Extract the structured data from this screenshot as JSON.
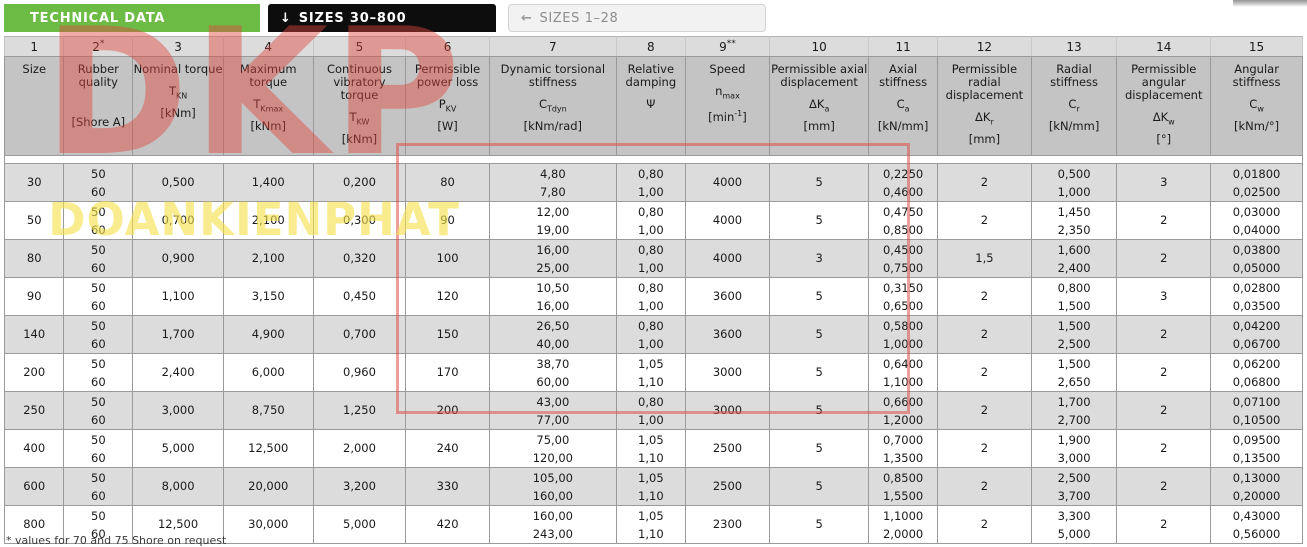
{
  "tabs": [
    {
      "label": "TECHNICAL DATA",
      "icon": "none",
      "state": "brand"
    },
    {
      "label": "SIZES 30–800",
      "icon": "down-arrow-icon",
      "arrow": "↓",
      "state": "active"
    },
    {
      "label": "SIZES 1–28",
      "icon": "left-arrow-icon",
      "arrow": "←",
      "state": "inactive"
    }
  ],
  "colors": {
    "brand_green": "#6cbb45",
    "active_tab": "#0d0d0d",
    "inactive_tab": "#f2f2f2",
    "header_number_bg": "#dcdcdc",
    "header_desc_bg": "#c4c4c4",
    "row_odd_bg": "#dcdcdc",
    "row_even_bg": "#ffffff",
    "watermark_red": "#e0483e",
    "watermark_yellow": "#f4e048"
  },
  "watermark": {
    "primary": "DKP",
    "secondary": "DOANKIENPHAT"
  },
  "footnote": "* values for 70 and 75 Shore on request",
  "table": {
    "column_numbers": [
      "1",
      "2",
      "3",
      "4",
      "5",
      "6",
      "7",
      "8",
      "9",
      "10",
      "11",
      "12",
      "13",
      "14",
      "15"
    ],
    "column_number_marks": [
      "",
      "*",
      "",
      "",
      "",
      "",
      "",
      "",
      "**",
      "",
      "",
      "",
      "",
      "",
      ""
    ],
    "columns": [
      {
        "name": "Size",
        "symbol": "",
        "unit": ""
      },
      {
        "name": "Rubber quality",
        "symbol": "",
        "unit": "[Shore A]"
      },
      {
        "name": "Nominal torque",
        "symbol": "T",
        "sub": "KN",
        "unit": "[kNm]"
      },
      {
        "name": "Maximum torque",
        "symbol": "T",
        "sub": "Kmax",
        "unit": "[kNm]"
      },
      {
        "name": "Continuous vibratory torque",
        "symbol": "T",
        "sub": "KW",
        "unit": "[kNm]"
      },
      {
        "name": "Permissible power loss",
        "symbol": "P",
        "sub": "KV",
        "unit": "[W]"
      },
      {
        "name": "Dynamic torsional stiffness",
        "symbol": "C",
        "sub": "Tdyn",
        "unit": "[kNm/rad]"
      },
      {
        "name": "Relative damping",
        "symbol": "Ψ",
        "sub": "",
        "unit": ""
      },
      {
        "name": "Speed",
        "symbol": "n",
        "sub": "max",
        "unit": "[min-1]"
      },
      {
        "name": "Permissible axial displacement",
        "symbol": "ΔK",
        "sub": "a",
        "unit": "[mm]"
      },
      {
        "name": "Axial stiffness",
        "symbol": "C",
        "sub": "a",
        "unit": "[kN/mm]"
      },
      {
        "name": "Permissible radial displacement",
        "symbol": "ΔK",
        "sub": "r",
        "unit": "[mm]"
      },
      {
        "name": "Radial stiffness",
        "symbol": "C",
        "sub": "r",
        "unit": "[kN/mm]"
      },
      {
        "name": "Permissible angular displacement",
        "symbol": "ΔK",
        "sub": "w",
        "unit": "[°]"
      },
      {
        "name": "Angular stiffness",
        "symbol": "C",
        "sub": "w",
        "unit": "[kNm/°]"
      }
    ],
    "rows": [
      {
        "size": "30",
        "rubber": [
          "50",
          "60"
        ],
        "tkn": "0,500",
        "tkmax": "1,400",
        "tkw": "0,200",
        "pkv": "80",
        "ctdyn": [
          "4,80",
          "7,80"
        ],
        "psi": [
          "0,80",
          "1,00"
        ],
        "nmax": "4000",
        "dka": "5",
        "ca": [
          "0,2250",
          "0,4600"
        ],
        "dkr": "2",
        "cr": [
          "0,500",
          "1,000"
        ],
        "dkw": "3",
        "cw": [
          "0,01800",
          "0,02500"
        ]
      },
      {
        "size": "50",
        "rubber": [
          "50",
          "60"
        ],
        "tkn": "0,700",
        "tkmax": "2,100",
        "tkw": "0,300",
        "pkv": "90",
        "ctdyn": [
          "12,00",
          "19,00"
        ],
        "psi": [
          "0,80",
          "1,00"
        ],
        "nmax": "4000",
        "dka": "5",
        "ca": [
          "0,4750",
          "0,8500"
        ],
        "dkr": "2",
        "cr": [
          "1,450",
          "2,350"
        ],
        "dkw": "2",
        "cw": [
          "0,03000",
          "0,04000"
        ]
      },
      {
        "size": "80",
        "rubber": [
          "50",
          "60"
        ],
        "tkn": "0,900",
        "tkmax": "2,100",
        "tkw": "0,320",
        "pkv": "100",
        "ctdyn": [
          "16,00",
          "25,00"
        ],
        "psi": [
          "0,80",
          "1,00"
        ],
        "nmax": "4000",
        "dka": "3",
        "ca": [
          "0,4500",
          "0,7500"
        ],
        "dkr": "1,5",
        "cr": [
          "1,600",
          "2,400"
        ],
        "dkw": "2",
        "cw": [
          "0,03800",
          "0,05000"
        ]
      },
      {
        "size": "90",
        "rubber": [
          "50",
          "60"
        ],
        "tkn": "1,100",
        "tkmax": "3,150",
        "tkw": "0,450",
        "pkv": "120",
        "ctdyn": [
          "10,50",
          "16,00"
        ],
        "psi": [
          "0,80",
          "1,00"
        ],
        "nmax": "3600",
        "dka": "5",
        "ca": [
          "0,3150",
          "0,6500"
        ],
        "dkr": "2",
        "cr": [
          "0,800",
          "1,500"
        ],
        "dkw": "3",
        "cw": [
          "0,02800",
          "0,03500"
        ]
      },
      {
        "size": "140",
        "rubber": [
          "50",
          "60"
        ],
        "tkn": "1,700",
        "tkmax": "4,900",
        "tkw": "0,700",
        "pkv": "150",
        "ctdyn": [
          "26,50",
          "40,00"
        ],
        "psi": [
          "0,80",
          "1,00"
        ],
        "nmax": "3600",
        "dka": "5",
        "ca": [
          "0,5800",
          "1,0000"
        ],
        "dkr": "2",
        "cr": [
          "1,500",
          "2,500"
        ],
        "dkw": "2",
        "cw": [
          "0,04200",
          "0,06700"
        ]
      },
      {
        "size": "200",
        "rubber": [
          "50",
          "60"
        ],
        "tkn": "2,400",
        "tkmax": "6,000",
        "tkw": "0,960",
        "pkv": "170",
        "ctdyn": [
          "38,70",
          "60,00"
        ],
        "psi": [
          "1,05",
          "1,10"
        ],
        "nmax": "3000",
        "dka": "5",
        "ca": [
          "0,6400",
          "1,1000"
        ],
        "dkr": "2",
        "cr": [
          "1,500",
          "2,650"
        ],
        "dkw": "2",
        "cw": [
          "0,06200",
          "0,06800"
        ]
      },
      {
        "size": "250",
        "rubber": [
          "50",
          "60"
        ],
        "tkn": "3,000",
        "tkmax": "8,750",
        "tkw": "1,250",
        "pkv": "200",
        "ctdyn": [
          "43,00",
          "77,00"
        ],
        "psi": [
          "0,80",
          "1,00"
        ],
        "nmax": "3000",
        "dka": "5",
        "ca": [
          "0,6600",
          "1,2000"
        ],
        "dkr": "2",
        "cr": [
          "1,700",
          "2,700"
        ],
        "dkw": "2",
        "cw": [
          "0,07100",
          "0,10500"
        ]
      },
      {
        "size": "400",
        "rubber": [
          "50",
          "60"
        ],
        "tkn": "5,000",
        "tkmax": "12,500",
        "tkw": "2,000",
        "pkv": "240",
        "ctdyn": [
          "75,00",
          "120,00"
        ],
        "psi": [
          "1,05",
          "1,10"
        ],
        "nmax": "2500",
        "dka": "5",
        "ca": [
          "0,7000",
          "1,3500"
        ],
        "dkr": "2",
        "cr": [
          "1,900",
          "3,000"
        ],
        "dkw": "2",
        "cw": [
          "0,09500",
          "0,13500"
        ]
      },
      {
        "size": "600",
        "rubber": [
          "50",
          "60"
        ],
        "tkn": "8,000",
        "tkmax": "20,000",
        "tkw": "3,200",
        "pkv": "330",
        "ctdyn": [
          "105,00",
          "160,00"
        ],
        "psi": [
          "1,05",
          "1,10"
        ],
        "nmax": "2500",
        "dka": "5",
        "ca": [
          "0,8500",
          "1,5500"
        ],
        "dkr": "2",
        "cr": [
          "2,500",
          "3,700"
        ],
        "dkw": "2",
        "cw": [
          "0,13000",
          "0,20000"
        ]
      },
      {
        "size": "800",
        "rubber": [
          "50",
          "60"
        ],
        "tkn": "12,500",
        "tkmax": "30,000",
        "tkw": "5,000",
        "pkv": "420",
        "ctdyn": [
          "160,00",
          "243,00"
        ],
        "psi": [
          "1,05",
          "1,10"
        ],
        "nmax": "2300",
        "dka": "5",
        "ca": [
          "1,1000",
          "2,0000"
        ],
        "dkr": "2",
        "cr": [
          "3,300",
          "5,000"
        ],
        "dkw": "2",
        "cw": [
          "0,43000",
          "0,56000"
        ]
      }
    ]
  }
}
